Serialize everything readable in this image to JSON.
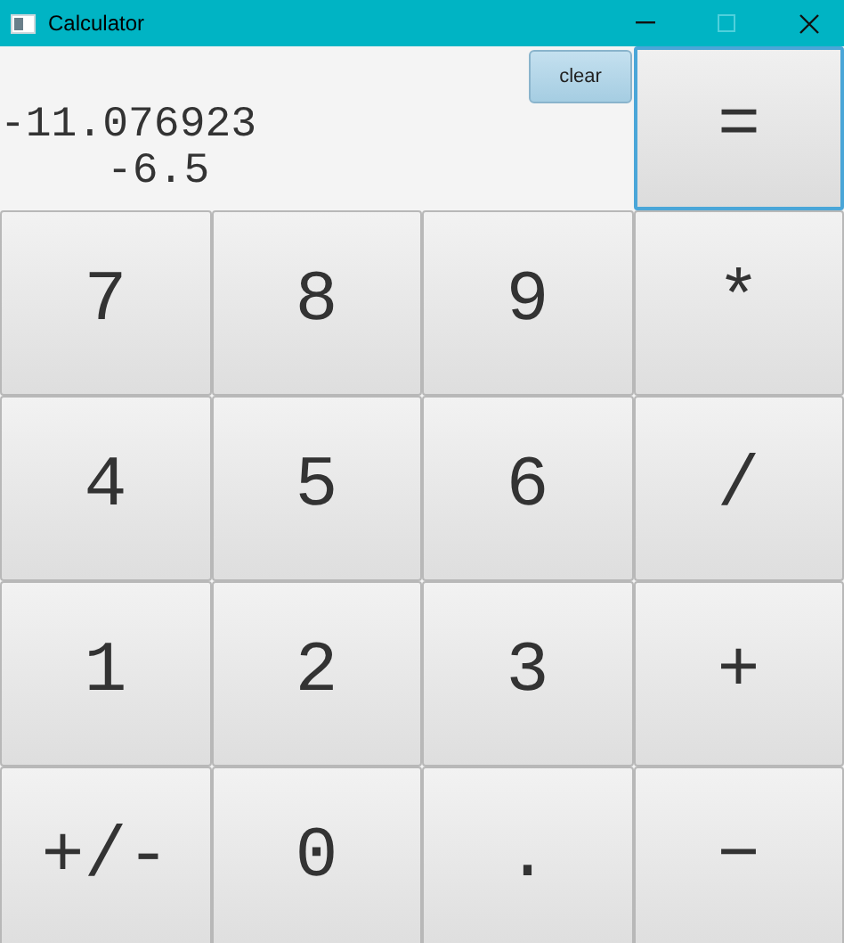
{
  "window": {
    "title": "Calculator",
    "maximize": {
      "disabled": true
    }
  },
  "display": {
    "lines": [
      "-11.076923",
      "-6.5"
    ]
  },
  "clear_button": {
    "label": "clear"
  },
  "equals_button": {
    "label": "=",
    "focused": true
  },
  "keys": [
    {
      "label": "7"
    },
    {
      "label": "8"
    },
    {
      "label": "9"
    },
    {
      "label": "*"
    },
    {
      "label": "4"
    },
    {
      "label": "5"
    },
    {
      "label": "6"
    },
    {
      "label": "/"
    },
    {
      "label": "1"
    },
    {
      "label": "2"
    },
    {
      "label": "3"
    },
    {
      "label": "+"
    },
    {
      "label": "+/-"
    },
    {
      "label": "0"
    },
    {
      "label": "."
    },
    {
      "label": "−"
    }
  ]
}
